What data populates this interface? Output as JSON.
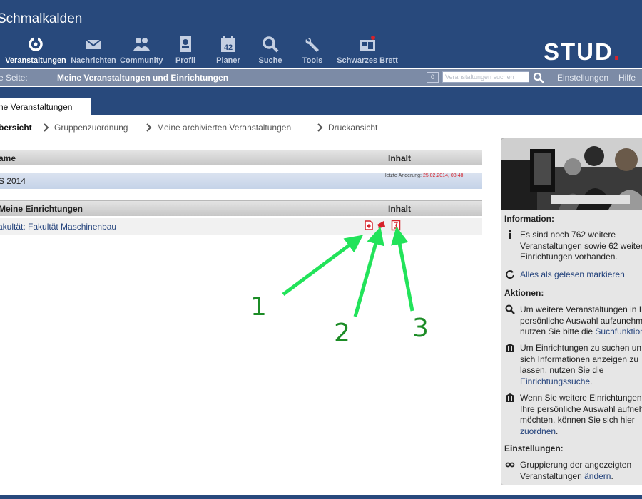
{
  "header": {
    "title": "Schmalkalden",
    "nav": [
      {
        "label": "Veranstaltungen",
        "icon": "seminar-icon",
        "active": true
      },
      {
        "label": "Nachrichten",
        "icon": "mail-icon"
      },
      {
        "label": "Community",
        "icon": "community-icon"
      },
      {
        "label": "Profil",
        "icon": "profile-icon"
      },
      {
        "label": "Planer",
        "icon": "calendar-icon"
      },
      {
        "label": "Suche",
        "icon": "search-icon"
      },
      {
        "label": "Tools",
        "icon": "wrench-icon"
      },
      {
        "label": "Schwarzes Brett",
        "icon": "board-icon"
      }
    ],
    "logo_text": "STUD",
    "logo_dot": "."
  },
  "subbar": {
    "page_label": "e Seite:",
    "page_value": "Meine Veranstaltungen und Einrichtungen",
    "count": "0",
    "search_placeholder": "Veranstaltungen suchen",
    "settings": "Einstellungen",
    "help": "Hilfe"
  },
  "tab": {
    "label": "ne Veranstaltungen"
  },
  "subnav": [
    "bersicht",
    "Gruppenzuordnung",
    "Meine archivierten Veranstaltungen",
    "Druckansicht"
  ],
  "courses_table": {
    "col_name": "ame",
    "col_content": "Inhalt",
    "rows": [
      {
        "name": "S 2014",
        "change_label": "letzte Änderung:",
        "change_date": "25.02.2014, 08:48"
      }
    ]
  },
  "institutes_table": {
    "col_name": "Meine Einrichtungen",
    "col_content": "Inhalt",
    "rows": [
      {
        "name": "akultät: Fakultät Maschinenbau"
      }
    ]
  },
  "annotations": [
    "1",
    "2",
    "3"
  ],
  "sidebar": {
    "info_title": "Information:",
    "info_text": "Es sind noch 762 weitere Veranstaltungen sowie 62 weiter Einrichtungen vorhanden.",
    "mark_read": "Alles als gelesen markieren",
    "actions_title": "Aktionen:",
    "action1_text": "Um weitere Veranstaltungen in Ih persönliche Auswahl aufzunehm nutzen Sie bitte die",
    "action1_link": "Suchfunktion",
    "action2_text": "Um Einrichtungen zu suchen un sich Informationen anzeigen zu lassen, nutzen Sie die",
    "action2_link": "Einrichtungssuche",
    "action2_end": ".",
    "action3_text": "Wenn Sie weitere Einrichtungen Ihre persönliche Auswahl aufneh möchten, können Sie sich hier",
    "action3_link": "zuordnen",
    "action3_end": ".",
    "settings_title": "Einstellungen:",
    "settings_text": "Gruppierung der angezeigten Veranstaltungen",
    "settings_link": "ändern",
    "settings_end": "."
  },
  "colors": {
    "header": "#28497c",
    "subbar": "#7c8ba6",
    "accent_red": "#d6232b",
    "annotation_green": "#22e35a",
    "link": "#24437c"
  }
}
